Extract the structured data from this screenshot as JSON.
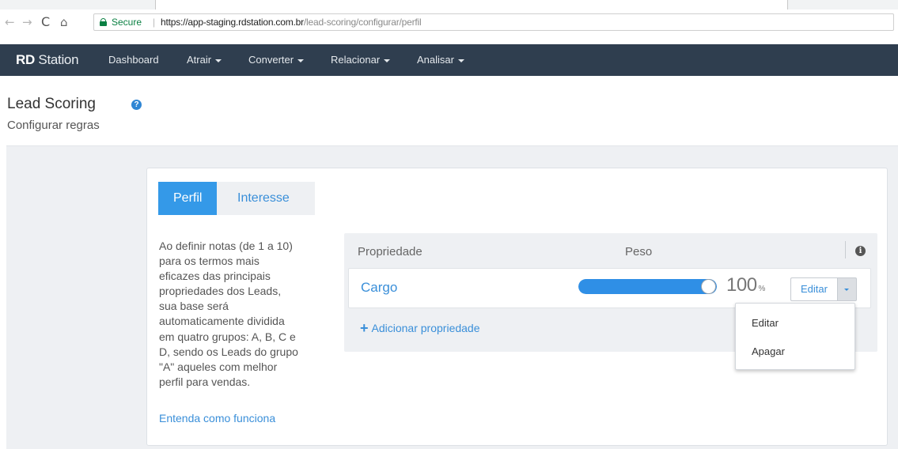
{
  "browser": {
    "nav": {
      "back": "←",
      "forward": "→",
      "reload": "C",
      "home": "⌂"
    },
    "secure_label": "Secure",
    "separator": "|",
    "url_host": "https://app-staging.rdstation.com.br",
    "url_path": "/lead-scoring/configurar/perfil"
  },
  "appnav": {
    "brand_bold": "RD",
    "brand_rest": "Station",
    "items": [
      "Dashboard",
      "Atrair",
      "Converter",
      "Relacionar",
      "Analisar"
    ]
  },
  "header": {
    "title": "Lead Scoring",
    "help_glyph": "?",
    "subtitle": "Configurar regras"
  },
  "tabs": {
    "active": "Perfil",
    "inactive": "Interesse"
  },
  "description": {
    "lines": [
      "Ao definir notas (de 1 a 10)",
      "para os termos mais",
      "eficazes das principais",
      "propriedades dos Leads,",
      "sua base será",
      "automaticamente dividida",
      "em quatro grupos: A, B, C e",
      "D, sendo os Leads do grupo",
      "\"A\" aqueles com melhor",
      "perfil para vendas."
    ],
    "link": "Entenda como funciona"
  },
  "table": {
    "col_property": "Propriedade",
    "col_weight": "Peso",
    "info_glyph": "i",
    "row": {
      "property": "Cargo",
      "weight_value": "100",
      "weight_unit": "%",
      "weight_fraction": 1.0,
      "edit_label": "Editar"
    },
    "add_label": "Adicionar propriedade",
    "add_glyph": "+"
  },
  "dropdown": {
    "items": [
      "Editar",
      "Apagar"
    ]
  },
  "colors": {
    "nav_bg": "#2f3e4f",
    "accent": "#3499e8",
    "link": "#3a8fd9"
  }
}
